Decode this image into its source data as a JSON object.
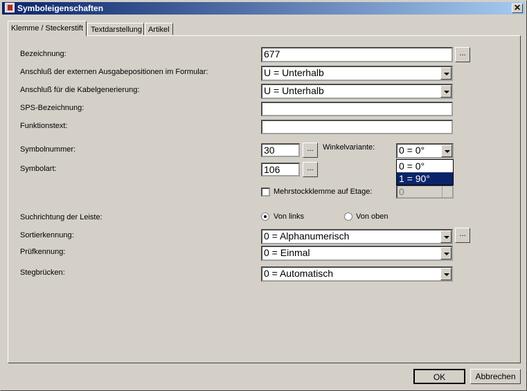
{
  "window": {
    "title": "Symboleigenschaften",
    "close_label": "✕"
  },
  "tabs": [
    {
      "label": "Klemme / Steckerstift",
      "active": true
    },
    {
      "label": "Textdarstellung",
      "active": false
    },
    {
      "label": "Artikel",
      "active": false
    }
  ],
  "form": {
    "bezeichnung": {
      "label": "Bezeichnung:",
      "value": "677",
      "button": "..."
    },
    "anschluss_formular": {
      "label": "Anschluß der externen Ausgabepositionen im Formular:",
      "value": "U = Unterhalb"
    },
    "anschluss_kabel": {
      "label": "Anschluß für die Kabelgenerierung:",
      "value": "U = Unterhalb"
    },
    "sps": {
      "label": "SPS-Bezeichnung:",
      "value": ""
    },
    "funktionstext": {
      "label": "Funktionstext:",
      "value": ""
    },
    "symbolnummer": {
      "label": "Symbolnummer:",
      "value": "30",
      "button": "..."
    },
    "winkelvariante": {
      "label": "Winkelvariante:",
      "value": "0 = 0°",
      "options": [
        "0 = 0°",
        "1 = 90°"
      ],
      "highlighted": "1 = 90°"
    },
    "symbolart": {
      "label": "Symbolart:",
      "value": "106",
      "button": "..."
    },
    "mehrstock": {
      "label": "Mehrstockklemme auf Etage:",
      "checked": false,
      "value": "0"
    },
    "suchrichtung": {
      "label": "Suchrichtung der Leiste:",
      "option_left": "Von links",
      "option_top": "Von oben",
      "selected": "Von links"
    },
    "sortierkennung": {
      "label": "Sortierkennung:",
      "value": "0 = Alphanumerisch",
      "button": "..."
    },
    "pruefkennung": {
      "label": "Prüfkennung:",
      "value": "0 = Einmal"
    },
    "stegbruecken": {
      "label": "Stegbrücken:",
      "value": "0 = Automatisch"
    }
  },
  "footer": {
    "ok": "OK",
    "cancel": "Abbrechen"
  }
}
